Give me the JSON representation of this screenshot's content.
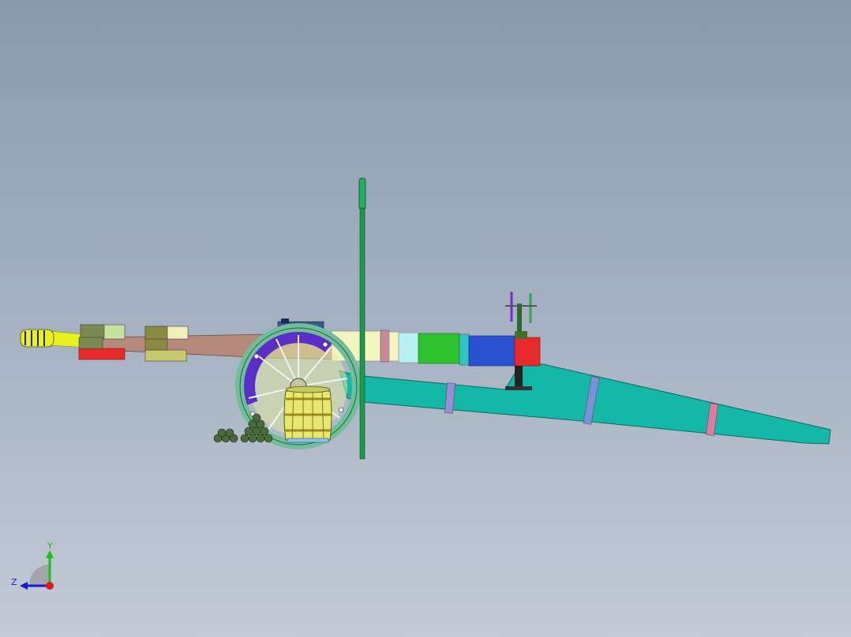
{
  "viewport": {
    "background_top": "#8a9aae",
    "background_bottom": "#c4cad6"
  },
  "model": {
    "description_icon": "cannon-on-carriage-3d-model",
    "colors": {
      "barrel_muzzle": "#e8f020",
      "barrel_body": "#b58a7c",
      "trail": "#13b8a8",
      "wheel_rim": "#5a2fc8",
      "wheel_outer": "#6fbf9a",
      "rammer_staff": "#1a9a4a",
      "barrel_segment_green": "#2ec22e",
      "barrel_segment_blue": "#2a52d0",
      "barrel_segment_red": "#e82a2a",
      "barrel_segment_cyan": "#b8f0f4",
      "barrel_segment_cream": "#f4f4c0",
      "barrel_band_pink": "#d0889a",
      "barrel_band_lavender": "#7a90d8",
      "keg": "#e8e870",
      "cannonballs": "#4a6a3a"
    }
  },
  "triad": {
    "y_label": "Y",
    "z_label": "Z",
    "y_color": "#18c018",
    "z_color": "#1818d0",
    "origin_color": "#e01818"
  }
}
